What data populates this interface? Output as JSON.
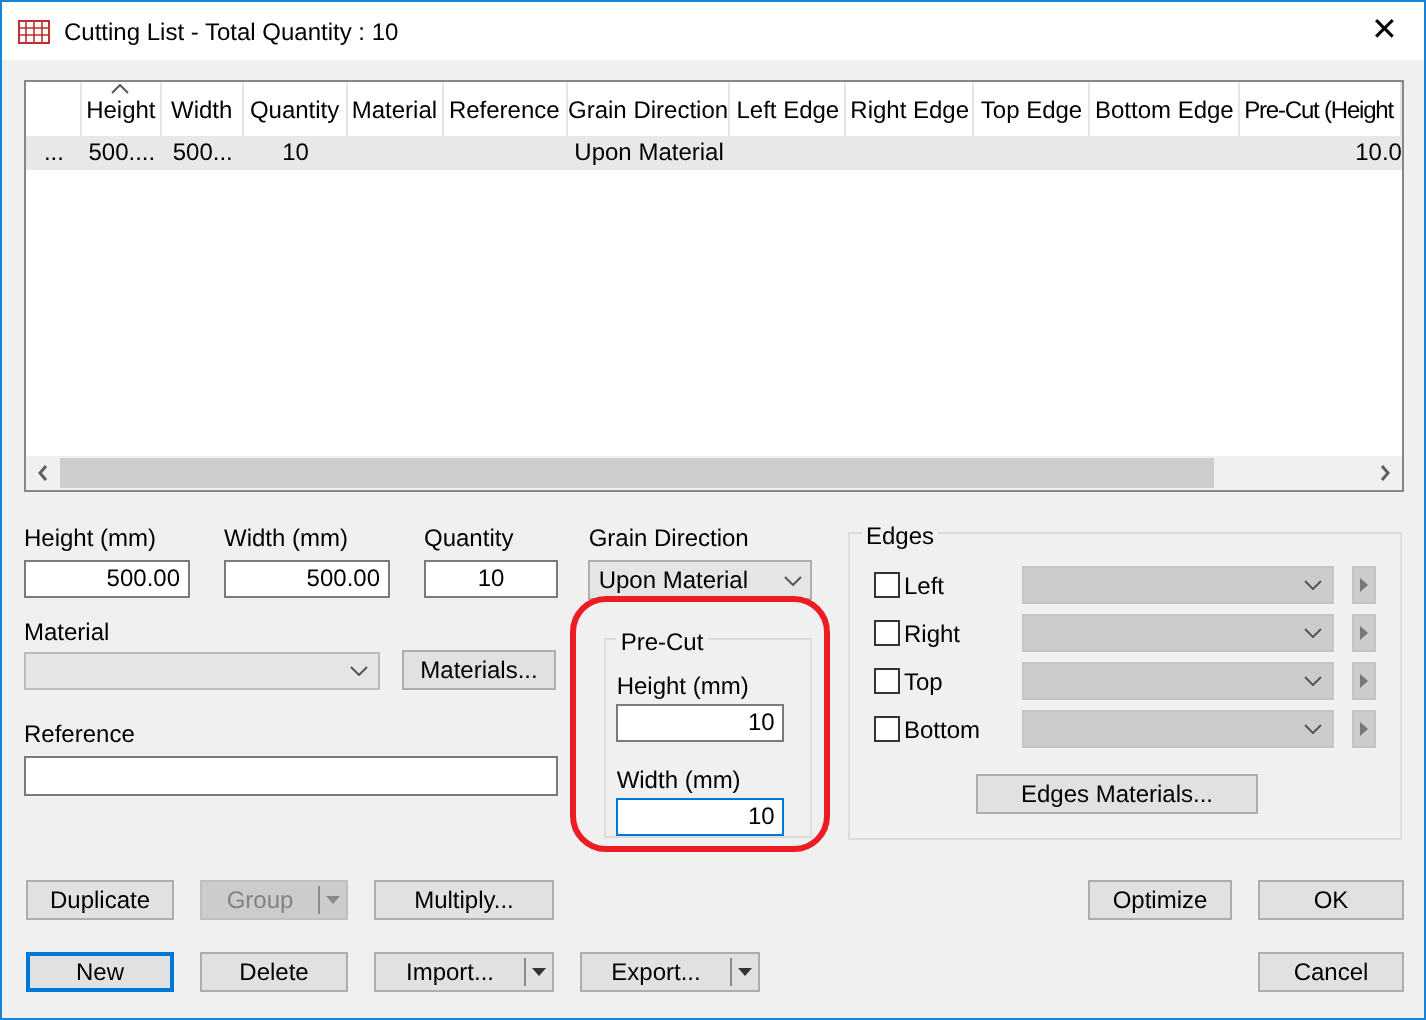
{
  "window": {
    "title": "Cutting List - Total Quantity : 10",
    "close": "✕"
  },
  "grid": {
    "columns": [
      {
        "sorted": false
      },
      {
        "label": "Height",
        "sorted": true
      },
      {
        "label": "Width",
        "sorted": false
      },
      {
        "label": "Quantity",
        "sorted": false
      },
      {
        "label": "Material",
        "sorted": false
      },
      {
        "label": "Reference",
        "sorted": false
      },
      {
        "label": "Grain Direction",
        "sorted": false
      },
      {
        "label": "Left Edge",
        "sorted": false
      },
      {
        "label": "Right Edge",
        "sorted": false
      },
      {
        "label": "Top Edge",
        "sorted": false
      },
      {
        "label": "Bottom Edge",
        "sorted": false
      },
      {
        "label": "Pre-Cut (Height",
        "sorted": false
      }
    ],
    "rows": [
      {
        "selected": true,
        "cells": [
          "...",
          "500....",
          "500...",
          "10",
          "",
          "",
          "Upon Material",
          "",
          "",
          "",
          "",
          "10.0"
        ]
      }
    ]
  },
  "form": {
    "height": {
      "label": "Height (mm)",
      "value": "500.00"
    },
    "width": {
      "label": "Width (mm)",
      "value": "500.00"
    },
    "quantity": {
      "label": "Quantity",
      "value": "10"
    },
    "grain_direction": {
      "label": "Grain Direction",
      "value": "Upon Material"
    },
    "material": {
      "label": "Material",
      "disabled": true
    },
    "materials_button": "Materials...",
    "reference": {
      "label": "Reference"
    },
    "precut": {
      "title": "Pre-Cut",
      "height": {
        "label": "Height (mm)",
        "value": "10",
        "focused": false
      },
      "width": {
        "label": "Width (mm)",
        "value": "10",
        "focused": true
      }
    },
    "edges": {
      "title": "Edges",
      "items": [
        {
          "label": "Left",
          "checked": false
        },
        {
          "label": "Right",
          "checked": false
        },
        {
          "label": "Top",
          "checked": false
        },
        {
          "label": "Bottom",
          "checked": false
        }
      ],
      "button": "Edges Materials..."
    }
  },
  "buttons": [
    [
      {
        "label": "Duplicate",
        "disabled": false,
        "split": false,
        "default": false
      },
      {
        "label": "Group",
        "disabled": true,
        "split": true,
        "default": false
      },
      {
        "label": "Multiply...",
        "disabled": false,
        "split": false,
        "default": false
      },
      {
        "label": "Optimize",
        "disabled": false,
        "split": false,
        "default": false,
        "right": true
      },
      {
        "label": "OK",
        "disabled": false,
        "split": false,
        "default": false,
        "right": true
      }
    ],
    [
      {
        "label": "New",
        "disabled": false,
        "split": false,
        "default": true
      },
      {
        "label": "Delete",
        "disabled": false,
        "split": false,
        "default": false
      },
      {
        "label": "Import...",
        "disabled": false,
        "split": true,
        "default": false
      },
      {
        "label": "Export...",
        "disabled": false,
        "split": true,
        "default": false
      },
      {
        "label": "Cancel",
        "disabled": false,
        "split": false,
        "default": false,
        "right": true
      }
    ]
  ]
}
